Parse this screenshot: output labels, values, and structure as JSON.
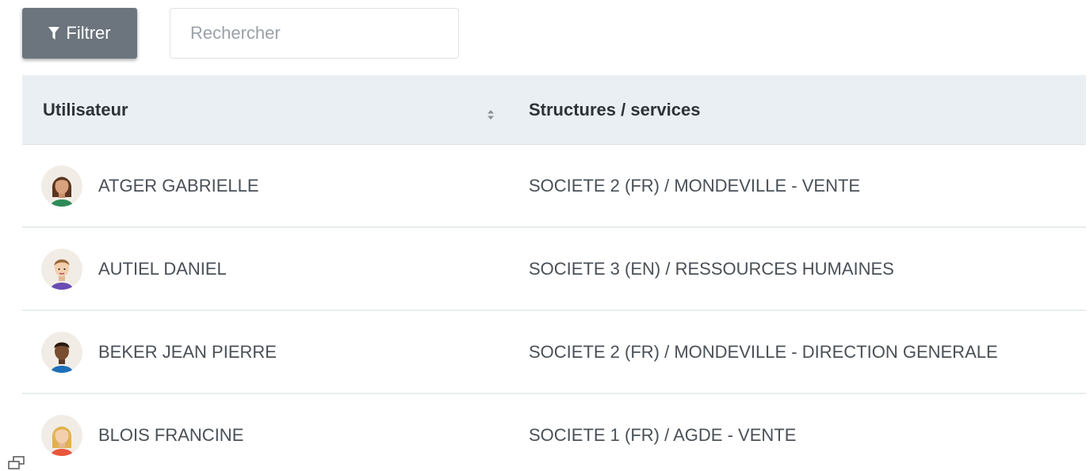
{
  "toolbar": {
    "filter_label": "Filtrer",
    "search_placeholder": "Rechercher",
    "search_value": ""
  },
  "table": {
    "columns": [
      "Utilisateur",
      "Structures / services"
    ],
    "rows": [
      {
        "name": "ATGER GABRIELLE",
        "structure": "SOCIETE 2 (FR) / MONDEVILLE - VENTE",
        "avatar": "woman-dark-hair-avatar"
      },
      {
        "name": "AUTIEL DANIEL",
        "structure": "SOCIETE 3 (EN) / RESSOURCES HUMAINES",
        "avatar": "man-light-hair-avatar"
      },
      {
        "name": "BEKER JEAN PIERRE",
        "structure": "SOCIETE 2 (FR) / MONDEVILLE - DIRECTION GENERALE",
        "avatar": "man-dark-skin-avatar"
      },
      {
        "name": "BLOIS FRANCINE",
        "structure": "SOCIETE 1 (FR) / AGDE - VENTE",
        "avatar": "woman-blonde-avatar"
      }
    ]
  },
  "colors": {
    "filter_button": "#6c757d",
    "header_background": "#eaeff4",
    "row_divider": "#e9ecef"
  }
}
